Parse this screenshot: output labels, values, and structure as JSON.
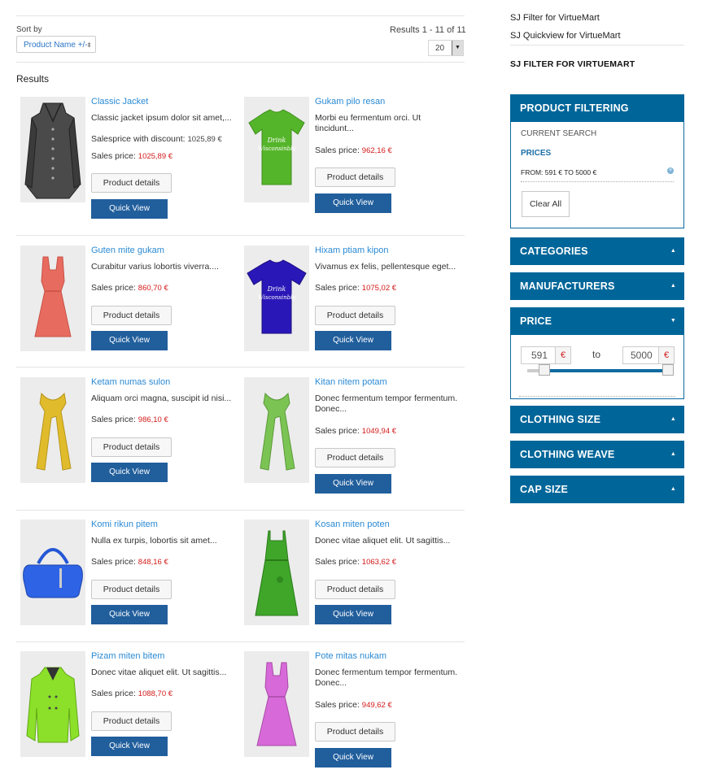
{
  "toolbar": {
    "sort_label": "Sort by",
    "sort_value": "Product Name +/-",
    "results_text": "Results 1 - 11 of 11",
    "limit_value": "20"
  },
  "results_title": "Results",
  "products": [
    {
      "name": "Classic Jacket",
      "desc": "Classic jacket ipsum dolor sit amet,...",
      "discount_label": "Salesprice with discount:",
      "discount_value": "1025,89 €",
      "price_label": "Sales price:",
      "price": "1025,89 €",
      "details": "Product details",
      "quickview": "Quick View"
    },
    {
      "name": "Gukam pilo resan",
      "desc": "Morbi eu fermentum orci. Ut tincidunt...",
      "price_label": "Sales price:",
      "price": "962,16 €",
      "details": "Product details",
      "quickview": "Quick View"
    },
    {
      "name": "Guten mite gukam",
      "desc": "Curabitur varius lobortis viverra....",
      "price_label": "Sales price:",
      "price": "860,70 €",
      "details": "Product details",
      "quickview": "Quick View"
    },
    {
      "name": "Hixam ptiam kipon",
      "desc": "Vivamus ex felis, pellentesque eget...",
      "price_label": "Sales price:",
      "price": "1075,02 €",
      "details": "Product details",
      "quickview": "Quick View"
    },
    {
      "name": "Ketam numas sulon",
      "desc": "Aliquam orci magna, suscipit id nisi...",
      "price_label": "Sales price:",
      "price": "986,10 €",
      "details": "Product details",
      "quickview": "Quick View"
    },
    {
      "name": "Kitan nitem potam",
      "desc": "Donec fermentum tempor fermentum. Donec...",
      "price_label": "Sales price:",
      "price": "1049,94 €",
      "details": "Product details",
      "quickview": "Quick View"
    },
    {
      "name": "Komi rikun pitem",
      "desc": "Nulla ex turpis, lobortis sit amet...",
      "price_label": "Sales price:",
      "price": "848,16 €",
      "details": "Product details",
      "quickview": "Quick View"
    },
    {
      "name": "Kosan miten poten",
      "desc": "Donec vitae aliquet elit. Ut sagittis...",
      "price_label": "Sales price:",
      "price": "1063,62 €",
      "details": "Product details",
      "quickview": "Quick View"
    },
    {
      "name": "Pizam miten bitem",
      "desc": "Donec vitae aliquet elit. Ut sagittis...",
      "price_label": "Sales price:",
      "price": "1088,70 €",
      "details": "Product details",
      "quickview": "Quick View"
    },
    {
      "name": "Pote mitas nukam",
      "desc": "Donec fermentum tempor fermentum. Donec...",
      "price_label": "Sales price:",
      "price": "949,62 €",
      "details": "Product details",
      "quickview": "Quick View"
    }
  ],
  "sidebar": {
    "links": [
      "SJ Filter for VirtueMart",
      "SJ Quickview for VirtueMart"
    ],
    "module_title": "SJ FILTER FOR VIRTUEMART",
    "filtering": {
      "title": "PRODUCT FILTERING",
      "current_search": "CURRENT SEARCH",
      "prices_label": "PRICES",
      "from_text": "FROM: 591 € TO 5000 €",
      "clear_all": "Clear All"
    },
    "categories": "CATEGORIES",
    "manufacturers": "MANUFACTURERS",
    "price": {
      "title": "PRICE",
      "min": "591",
      "max": "5000",
      "currency": "€",
      "to": "to"
    },
    "clothing_size": "CLOTHING SIZE",
    "clothing_weave": "CLOTHING WEAVE",
    "cap_size": "CAP SIZE"
  },
  "colors": {
    "accent": "#006699",
    "button": "#215e9c",
    "link": "#2a8ad4",
    "price": "#d31a1a"
  }
}
